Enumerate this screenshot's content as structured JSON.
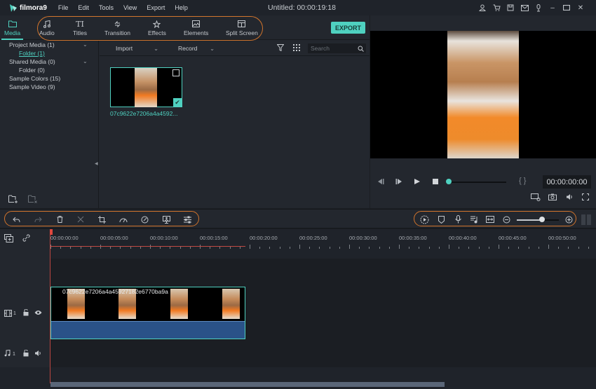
{
  "app": {
    "name": "filmora9",
    "window_title": "Untitled:  00:00:19:18",
    "menu": [
      "File",
      "Edit",
      "Tools",
      "View",
      "Export",
      "Help"
    ],
    "window_icons": [
      "account-icon",
      "cart-icon",
      "save-icon",
      "mail-icon",
      "download-icon",
      "minimize-icon",
      "maximize-icon",
      "close-icon"
    ]
  },
  "tabs": [
    {
      "label": "Media",
      "icon": "folder-icon",
      "active": true
    },
    {
      "label": "Audio",
      "icon": "music-note-icon"
    },
    {
      "label": "Titles",
      "icon": "text-icon"
    },
    {
      "label": "Transition",
      "icon": "transition-icon"
    },
    {
      "label": "Effects",
      "icon": "effects-icon"
    },
    {
      "label": "Elements",
      "icon": "image-icon"
    },
    {
      "label": "Split Screen",
      "icon": "split-screen-icon"
    }
  ],
  "export_label": "EXPORT",
  "library": {
    "tree": [
      {
        "label": "Project Media (1)",
        "expandable": true
      },
      {
        "label": "Folder (1)",
        "selected": true
      },
      {
        "label": "Shared Media (0)",
        "expandable": true
      },
      {
        "label": "Folder (0)"
      },
      {
        "label": "Sample Colors (15)"
      },
      {
        "label": "Sample Video (9)"
      }
    ],
    "import_label": "Import",
    "record_label": "Record",
    "search_placeholder": "Search",
    "media_items": [
      {
        "name": "07c9622e7206a4a4592...",
        "selected": true
      }
    ]
  },
  "preview": {
    "timecode": "00:00:00:00",
    "brackets": "{  }",
    "progress": 0
  },
  "timeline": {
    "ruler_labels": [
      "00:00:00:00",
      "00:00:05:00",
      "00:00:10:00",
      "00:00:15:00",
      "00:00:20:00",
      "00:00:25:00",
      "00:00:30:00",
      "00:00:35:00",
      "00:00:40:00",
      "00:00:45:00",
      "00:00:50:00"
    ],
    "video_track": {
      "number": "1",
      "clip_name": "07c9622e7206a4a45927182e6770ba9a"
    },
    "audio_track": {
      "number": "1"
    },
    "zoom_level": 0.6
  },
  "colors": {
    "accent": "#4fd1c0",
    "highlight_oval": "#d1742c",
    "playhead": "#e0483e"
  }
}
